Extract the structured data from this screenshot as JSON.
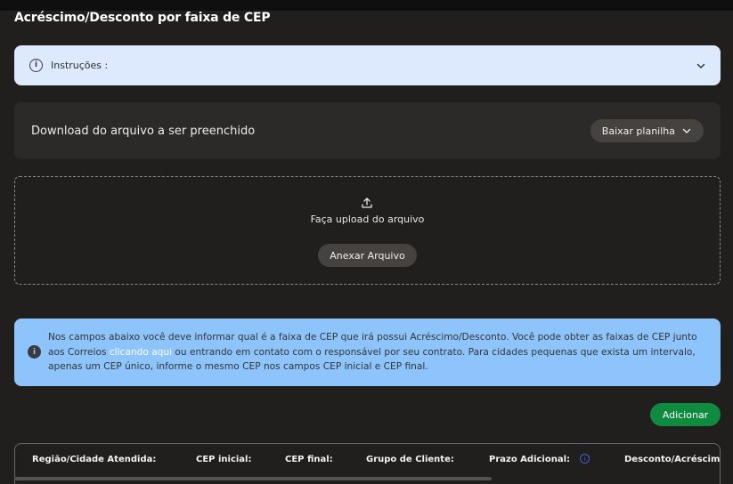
{
  "page": {
    "title": "Acréscimo/Desconto por faixa de CEP"
  },
  "instructions": {
    "icon": "info-icon",
    "label": "Instruções :"
  },
  "download": {
    "text": "Download do arquivo a ser preenchido",
    "button_label": "Baixar planilha"
  },
  "upload": {
    "icon": "upload-icon",
    "text": "Faça upload do arquivo",
    "button_label": "Anexar Arquivo"
  },
  "notice": {
    "icon": "info-icon",
    "text_before": "Nos campos abaixo você deve informar qual é a faixa de CEP que irá possui Acréscimo/Desconto. Você pode obter as faixas de CEP junto aos Correios ",
    "link": "clicando aqui",
    "text_after": " ou entrando em contato com o responsável por seu contrato. Para cidades pequenas que exista um intervalo, apenas um CEP único, informe o mesmo CEP nos campos CEP inicial e CEP final."
  },
  "add_button": {
    "label": "Adicionar"
  },
  "table": {
    "columns": [
      "Região/Cidade Atendida:",
      "CEP inicial:",
      "CEP final:",
      "Grupo de Cliente:",
      "Prazo Adicional:",
      "Desconto/Acréscimo"
    ]
  },
  "colors": {
    "background": "#211f1d",
    "instructions_bg": "#dde9fc",
    "notice_bg": "#8cc4fb",
    "add_button": "#0f8b40"
  }
}
